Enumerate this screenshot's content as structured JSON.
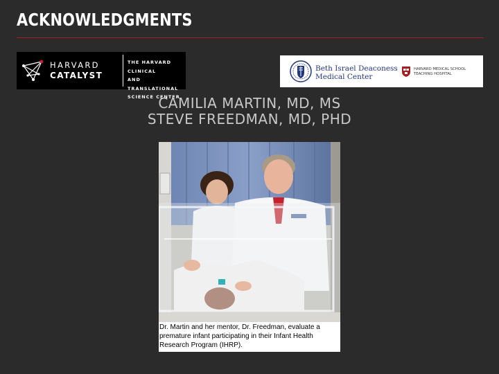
{
  "slide": {
    "title": "ACKNOWLEDGMENTS",
    "accent_color": "#b01e23",
    "background_color": "#2b2b2b"
  },
  "logos": {
    "harvard_catalyst": {
      "name_line1": "HARVARD",
      "name_line2": "CATALYST",
      "sub_line1": "THE HARVARD CLINICAL",
      "sub_line2": "AND TRANSLATIONAL",
      "sub_line3": "SCIENCE CENTER"
    },
    "bidmc": {
      "name_line1": "Beth Israel Deaconess",
      "name_line2": "Medical Center",
      "affiliation_line1": "HARVARD MEDICAL SCHOOL",
      "affiliation_line2": "TEACHING HOSPITAL"
    }
  },
  "people": {
    "line1": "CAMILIA MARTIN, MD, MS",
    "line2": "STEVE FREEDMAN, MD, PHD"
  },
  "photo": {
    "caption": "Dr. Martin and her mentor, Dr. Freedman, evaluate a premature infant participating in their Infant Health Research Program (IHRP)."
  }
}
